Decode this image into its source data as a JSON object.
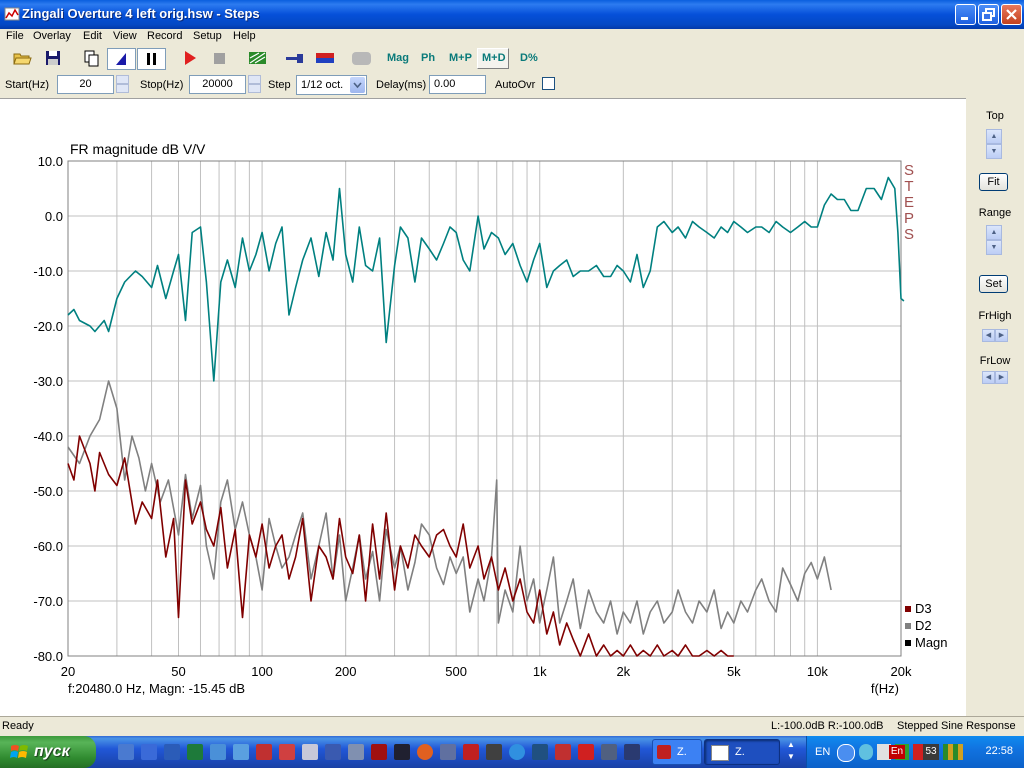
{
  "window": {
    "title": "Zingali Overture 4 left orig.hsw - Steps",
    "controls": [
      "minimize",
      "maximize",
      "close"
    ]
  },
  "menu": [
    "File",
    "Overlay",
    "Edit",
    "View",
    "Record",
    "Setup",
    "Help"
  ],
  "toolbar": {
    "icons": [
      "open-folder-icon",
      "save-icon",
      "copy-icon",
      "stepped-sine-icon",
      "pause-icon",
      "record-icon",
      "stop-icon",
      "calibrate-icon",
      "probe-icon",
      "color-icon",
      "blank-icon"
    ],
    "mag_label": "Mag",
    "ph_label": "Ph",
    "mp_label": "M+P",
    "md_label": "M+D",
    "dpct_label": "D%"
  },
  "params": {
    "start_label": "Start(Hz)",
    "start_value": "20",
    "stop_label": "Stop(Hz)",
    "stop_value": "20000",
    "step_label": "Step",
    "step_value": "1/12 oct.",
    "delay_label": "Delay(ms)",
    "delay_value": "0.00",
    "autoovr_label": "AutoOvr",
    "autoovr_checked": false
  },
  "right_panel": {
    "top_label": "Top",
    "fit_label": "Fit",
    "range_label": "Range",
    "set_label": "Set",
    "frhigh_label": "FrHigh",
    "frlow_label": "FrLow"
  },
  "plot": {
    "side_label": "STEPS",
    "cursor_readout": "f:20480.0 Hz, Magn: -15.45 dB",
    "colors": {
      "magn": "#008080",
      "d2": "#808080",
      "d3": "#800000",
      "grid": "#c0c0c0"
    }
  },
  "chart_data": {
    "type": "line",
    "title": "FR magnitude dB V/V",
    "xlabel": "f(Hz)",
    "ylabel": "",
    "x_scale": "log",
    "xlim": [
      20,
      20000
    ],
    "ylim": [
      -80,
      10
    ],
    "grid": true,
    "legend_position": "bottom-right",
    "y_ticks": [
      "10.0",
      "0.0",
      "-10.0",
      "-20.0",
      "-30.0",
      "-40.0",
      "-50.0",
      "-60.0",
      "-70.0",
      "-80.0"
    ],
    "x_ticks": [
      {
        "value": 20,
        "label": "20"
      },
      {
        "value": 50,
        "label": "50"
      },
      {
        "value": 100,
        "label": "100"
      },
      {
        "value": 200,
        "label": "200"
      },
      {
        "value": 500,
        "label": "500"
      },
      {
        "value": 1000,
        "label": "1k"
      },
      {
        "value": 2000,
        "label": "2k"
      },
      {
        "value": 5000,
        "label": "5k"
      },
      {
        "value": 10000,
        "label": "10k"
      },
      {
        "value": 20000,
        "label": "20k"
      }
    ],
    "legend": [
      {
        "name": "D3",
        "color": "#800000"
      },
      {
        "name": "D2",
        "color": "#808080"
      },
      {
        "name": "Magn",
        "color": "#000000"
      }
    ],
    "series": [
      {
        "name": "Magn",
        "color": "#008080",
        "x": [
          20,
          21,
          22,
          24,
          25,
          27,
          28,
          30,
          32,
          35,
          37,
          40,
          42,
          45,
          48,
          50,
          53,
          56,
          60,
          63,
          67,
          71,
          75,
          80,
          85,
          90,
          95,
          100,
          106,
          112,
          118,
          125,
          132,
          140,
          150,
          160,
          170,
          180,
          190,
          200,
          212,
          224,
          236,
          250,
          265,
          280,
          300,
          315,
          335,
          355,
          375,
          400,
          425,
          450,
          475,
          500,
          530,
          560,
          600,
          630,
          670,
          710,
          750,
          800,
          850,
          900,
          950,
          1000,
          1060,
          1120,
          1180,
          1250,
          1320,
          1400,
          1500,
          1600,
          1700,
          1800,
          1900,
          2000,
          2120,
          2240,
          2360,
          2500,
          2650,
          2800,
          3000,
          3150,
          3350,
          3550,
          3750,
          4000,
          4250,
          4500,
          4750,
          5000,
          5300,
          5600,
          6000,
          6300,
          6700,
          7100,
          7500,
          8000,
          8500,
          9000,
          9500,
          10000,
          10600,
          11200,
          11800,
          12500,
          13200,
          14000,
          15000,
          16000,
          17000,
          18000,
          19000,
          19500,
          20000,
          20480
        ],
        "y": [
          -18,
          -17,
          -19,
          -20,
          -21,
          -19,
          -21,
          -15,
          -12,
          -10,
          -11,
          -13,
          -9,
          -15,
          -10,
          -7,
          -19,
          -3,
          -2,
          -12,
          -30,
          -12,
          -8,
          -13,
          -4,
          -10,
          -7,
          -3,
          -10,
          -5,
          -2,
          -18,
          -13,
          -8,
          -4,
          -11,
          -3,
          -8,
          5,
          -7,
          -12,
          -2,
          -9,
          -10,
          -4,
          -23,
          -9,
          -2,
          -4,
          -12,
          -4,
          -6,
          -8,
          -5,
          -2,
          -3,
          -8,
          -10,
          0,
          -6,
          -3,
          -4,
          -7,
          -5,
          -9,
          -12,
          -8,
          -5,
          -13,
          -10,
          -9,
          -8,
          -11,
          -10,
          -10,
          -9,
          -11,
          -11,
          -9,
          -10,
          -12,
          -7,
          -13,
          -10,
          -2,
          -1,
          -3,
          -2,
          -4,
          -1,
          -2,
          -3,
          -4,
          -2,
          -3,
          -1,
          -2,
          -3,
          -2,
          -2,
          -3,
          -1,
          -2,
          -3,
          -2,
          -1,
          -2,
          -2,
          2,
          4,
          3,
          3,
          1,
          1,
          5,
          5,
          3,
          7,
          5,
          -3,
          -15,
          -15.45
        ]
      },
      {
        "name": "D2",
        "color": "#808080",
        "x": [
          20,
          22,
          24,
          26,
          28,
          30,
          32,
          34,
          36,
          38,
          40,
          43,
          46,
          50,
          53,
          56,
          60,
          63,
          67,
          71,
          75,
          80,
          85,
          90,
          95,
          100,
          106,
          112,
          118,
          125,
          132,
          140,
          150,
          160,
          170,
          180,
          190,
          200,
          212,
          224,
          236,
          250,
          265,
          280,
          300,
          315,
          335,
          355,
          375,
          400,
          425,
          450,
          475,
          500,
          530,
          560,
          600,
          630,
          670,
          700,
          710,
          750,
          800,
          850,
          900,
          950,
          1000,
          1060,
          1120,
          1180,
          1250,
          1320,
          1400,
          1500,
          1600,
          1700,
          1800,
          1900,
          2000,
          2120,
          2240,
          2360,
          2500,
          2650,
          2800,
          3000,
          3150,
          3350,
          3550,
          3750,
          4000,
          4250,
          4500,
          4750,
          5000,
          5300,
          5600,
          6000,
          6300,
          6700,
          7100,
          7500,
          8000,
          8500,
          9000,
          9500,
          10000,
          10600,
          11200
        ],
        "y": [
          -42,
          -45,
          -40,
          -37,
          -30,
          -35,
          -48,
          -40,
          -44,
          -50,
          -45,
          -52,
          -48,
          -58,
          -47,
          -55,
          -49,
          -60,
          -66,
          -52,
          -48,
          -57,
          -52,
          -58,
          -62,
          -68,
          -55,
          -60,
          -64,
          -62,
          -58,
          -54,
          -66,
          -60,
          -54,
          -66,
          -58,
          -70,
          -64,
          -58,
          -66,
          -61,
          -70,
          -57,
          -64,
          -60,
          -68,
          -63,
          -56,
          -58,
          -64,
          -67,
          -62,
          -65,
          -62,
          -72,
          -66,
          -70,
          -62,
          -48,
          -74,
          -68,
          -72,
          -60,
          -70,
          -66,
          -74,
          -68,
          -62,
          -74,
          -70,
          -66,
          -75,
          -68,
          -72,
          -74,
          -70,
          -76,
          -72,
          -74,
          -70,
          -76,
          -72,
          -70,
          -74,
          -72,
          -68,
          -72,
          -74,
          -70,
          -72,
          -68,
          -75,
          -72,
          -74,
          -70,
          -72,
          -68,
          -66,
          -70,
          -72,
          -64,
          -67,
          -70,
          -65,
          -63,
          -66,
          -62,
          -68
        ]
      },
      {
        "name": "D3",
        "color": "#800000",
        "x": [
          20,
          21,
          22,
          24,
          25,
          26,
          28,
          30,
          32,
          35,
          37,
          40,
          42,
          45,
          48,
          50,
          53,
          56,
          60,
          63,
          67,
          71,
          75,
          80,
          85,
          90,
          95,
          100,
          106,
          112,
          118,
          125,
          132,
          140,
          150,
          160,
          170,
          180,
          190,
          200,
          212,
          224,
          236,
          250,
          265,
          280,
          300,
          315,
          335,
          355,
          375,
          400,
          425,
          450,
          475,
          500,
          530,
          560,
          600,
          630,
          670,
          710,
          750,
          800,
          850,
          900,
          950,
          1000,
          1060,
          1120,
          1180,
          1250,
          1320,
          1400,
          1500,
          1600,
          1700,
          1800,
          1900,
          2000,
          2120,
          2240,
          2360,
          2500,
          2650,
          2800,
          3000,
          3150,
          3350,
          3550,
          3750,
          4000,
          4250,
          4500,
          4750,
          5000
        ],
        "y": [
          -45,
          -48,
          -40,
          -45,
          -50,
          -43,
          -47,
          -49,
          -44,
          -56,
          -52,
          -55,
          -48,
          -62,
          -55,
          -73,
          -48,
          -56,
          -52,
          -57,
          -60,
          -53,
          -64,
          -57,
          -73,
          -58,
          -62,
          -56,
          -64,
          -60,
          -58,
          -66,
          -62,
          -55,
          -70,
          -60,
          -62,
          -66,
          -55,
          -62,
          -65,
          -58,
          -70,
          -56,
          -66,
          -54,
          -68,
          -60,
          -64,
          -58,
          -60,
          -62,
          -58,
          -57,
          -60,
          -62,
          -56,
          -64,
          -60,
          -66,
          -62,
          -68,
          -64,
          -70,
          -66,
          -72,
          -74,
          -68,
          -76,
          -72,
          -78,
          -74,
          -77,
          -80,
          -76,
          -80,
          -78,
          -80,
          -79,
          -80,
          -78,
          -80,
          -79,
          -80,
          -78,
          -80,
          -79,
          -80,
          -78,
          -80,
          -80,
          -79,
          -80,
          -79,
          -80,
          -80
        ]
      }
    ]
  },
  "status": {
    "left": "Ready",
    "levels": "L:-100.0dB  R:-100.0dB",
    "mode": "Stepped Sine Response"
  },
  "taskbar": {
    "start_label": "пуск",
    "tasks": [
      {
        "label": "Z."
      },
      {
        "label": "Z."
      }
    ],
    "lang": "EN",
    "lang2": "En",
    "tray_num": "53",
    "clock": "22:58"
  }
}
